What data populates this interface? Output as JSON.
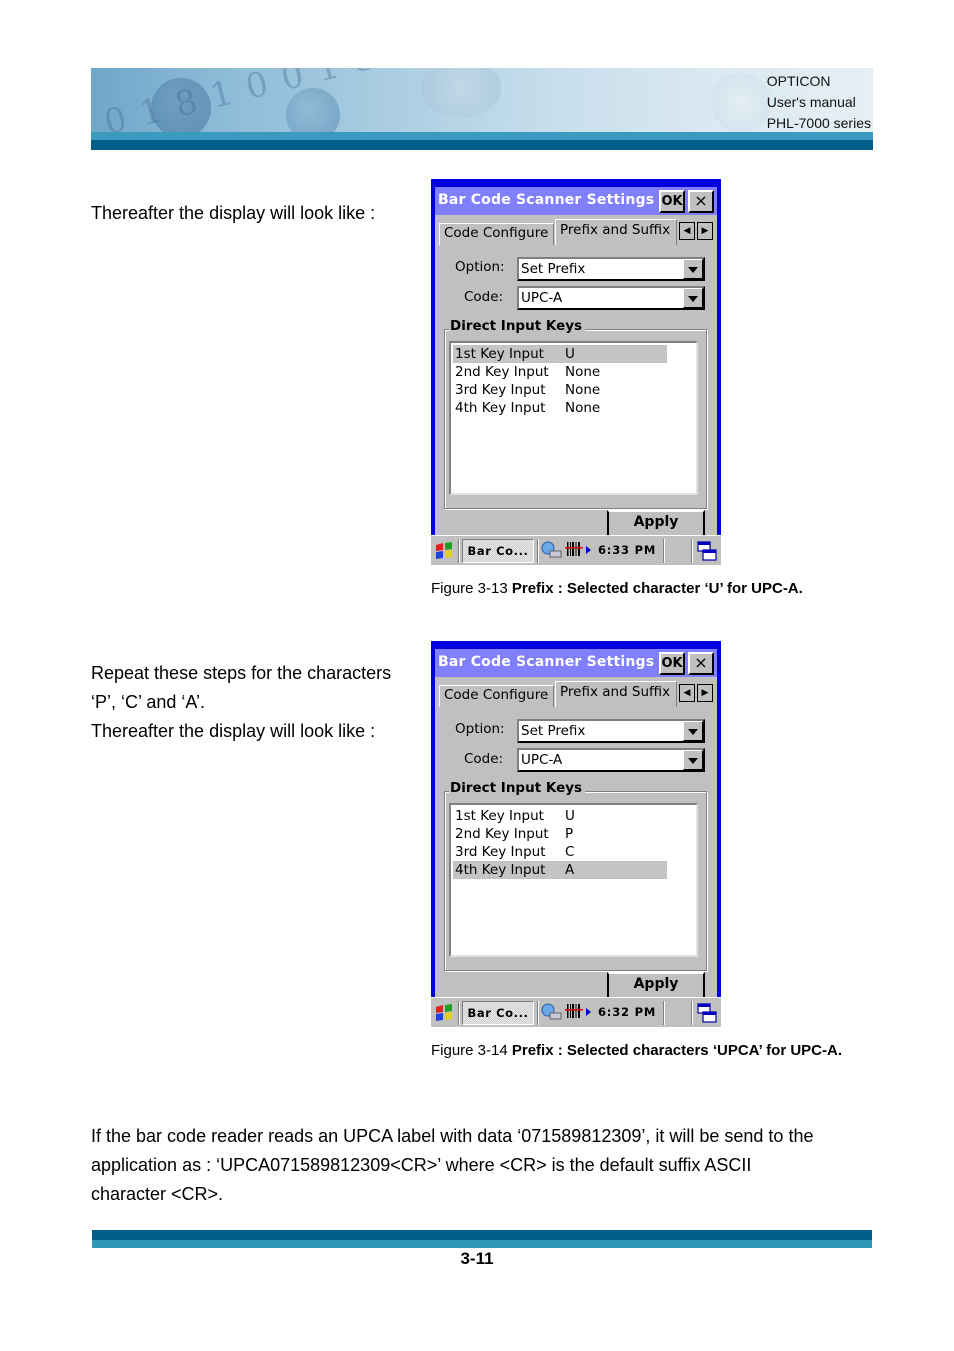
{
  "header": {
    "company": "OPTICON",
    "doc_type": "User's manual",
    "series": "PHL-7000 series"
  },
  "section1": {
    "text": "Thereafter the display will look like :"
  },
  "section2": {
    "line1": "Repeat these steps for the characters",
    "line2": "‘P’, ‘C’ and ‘A’.",
    "line3": "Thereafter the display will look like :"
  },
  "screens": [
    {
      "window_title": "Bar Code Scanner Settings",
      "ok_label": "OK",
      "close_label": "×",
      "tabs": [
        "Code Configure",
        "Prefix and Suffix"
      ],
      "active_tab": "Prefix and Suffix",
      "option_label": "Option:",
      "option_value": "Set Prefix",
      "code_label": "Code:",
      "code_value": "UPC-A",
      "group_title": "Direct Input Keys",
      "rows": [
        {
          "key": "1st  Key Input",
          "value": "U",
          "selected": true
        },
        {
          "key": "2nd Key Input",
          "value": "None",
          "selected": false
        },
        {
          "key": "3rd Key Input",
          "value": "None",
          "selected": false
        },
        {
          "key": "4th Key Input",
          "value": "None",
          "selected": false
        }
      ],
      "apply_label": "Apply",
      "taskbar_app": "Bar Co...",
      "clock": "6:33 PM",
      "caption_prefix": "Figure 3-13 ",
      "caption_bold": "Prefix : Selected character ‘U’ for UPC-A."
    },
    {
      "window_title": "Bar Code Scanner Settings",
      "ok_label": "OK",
      "close_label": "×",
      "tabs": [
        "Code Configure",
        "Prefix and Suffix"
      ],
      "active_tab": "Prefix and Suffix",
      "option_label": "Option:",
      "option_value": "Set Prefix",
      "code_label": "Code:",
      "code_value": "UPC-A",
      "group_title": "Direct Input Keys",
      "rows": [
        {
          "key": "1st  Key Input",
          "value": "U",
          "selected": false
        },
        {
          "key": "2nd Key Input",
          "value": "P",
          "selected": false
        },
        {
          "key": "3rd Key Input",
          "value": "C",
          "selected": false
        },
        {
          "key": "4th Key Input",
          "value": "A",
          "selected": true
        }
      ],
      "apply_label": "Apply",
      "taskbar_app": "Bar Co...",
      "clock": "6:32 PM",
      "caption_prefix": "Figure 3-14 ",
      "caption_bold": "Prefix : Selected characters ‘UPCA’ for UPC-A."
    }
  ],
  "closing": {
    "line1": "If the bar code reader reads an UPCA label with data ‘071589812309’, it will be send to the",
    "line2": "application as : ‘UPCA071589812309<CR>’ where <CR> is the default suffix ASCII",
    "line3": "character <CR>."
  },
  "footer": {
    "page_number": "3-11"
  }
}
